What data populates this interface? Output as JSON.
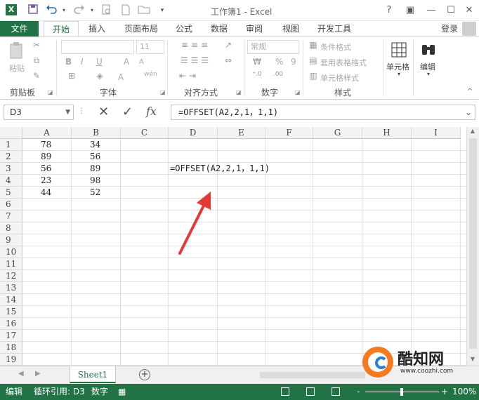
{
  "window": {
    "title": "工作簿1 - Excel",
    "help": "?",
    "restore": "▣",
    "minimize": "—",
    "maximize": "☐",
    "close": "✕"
  },
  "qat": {
    "save_icon": "save-icon",
    "undo_icon": "undo-icon",
    "redo_icon": "redo-icon"
  },
  "tabs": [
    "文件",
    "开始",
    "插入",
    "页面布局",
    "公式",
    "数据",
    "审阅",
    "视图",
    "开发工具"
  ],
  "active_tab": "开始",
  "login": "登录",
  "ribbon": {
    "clipboard": {
      "paste": "粘贴",
      "label": "剪贴板"
    },
    "font": {
      "size": "11",
      "bold": "B",
      "italic": "I",
      "underline": "U",
      "grow": "A",
      "shrink": "A",
      "font_color": "A",
      "wen": "wén",
      "label": "字体"
    },
    "alignment": {
      "label": "对齐方式"
    },
    "number": {
      "format": "常规",
      "percent": "%",
      "comma": "9",
      "label": "数字"
    },
    "styles": {
      "conditional": "条件格式",
      "table": "套用表格格式",
      "cell_styles": "单元格样式",
      "label": "样式"
    },
    "cells": {
      "label": "单元格"
    },
    "editing": {
      "label": "编辑"
    }
  },
  "formula_bar": {
    "name_box": "D3",
    "cancel": "✕",
    "enter": "✓",
    "fx": "fx",
    "formula": "=OFFSET(A2,2,1，1,1)"
  },
  "columns": [
    "A",
    "B",
    "C",
    "D",
    "E",
    "F",
    "G",
    "H",
    "I"
  ],
  "rows": [
    "1",
    "2",
    "3",
    "4",
    "5",
    "6",
    "7",
    "8",
    "9",
    "10",
    "11",
    "12",
    "13",
    "14",
    "15",
    "16",
    "17",
    "18",
    "19"
  ],
  "cells": {
    "A1": "78",
    "B1": "34",
    "A2": "89",
    "B2": "56",
    "A3": "56",
    "B3": "89",
    "A4": "23",
    "B4": "98",
    "A5": "44",
    "B5": "52",
    "D3": "=OFFSET(A2,2,1，1,1)"
  },
  "annotation": {
    "arrow_color": "#e53935"
  },
  "sheets": {
    "active": "Sheet1",
    "add": "+"
  },
  "status_bar": {
    "mode": "编辑",
    "circular": "循环引用: D3",
    "digits": "数字",
    "zoom_minus": "-",
    "zoom_plus": "+",
    "zoom": "100%"
  },
  "watermark": {
    "title": "酷知网",
    "url": "www.coozhi.com"
  },
  "colors": {
    "brand": "#217346",
    "arrow": "#e53935"
  }
}
